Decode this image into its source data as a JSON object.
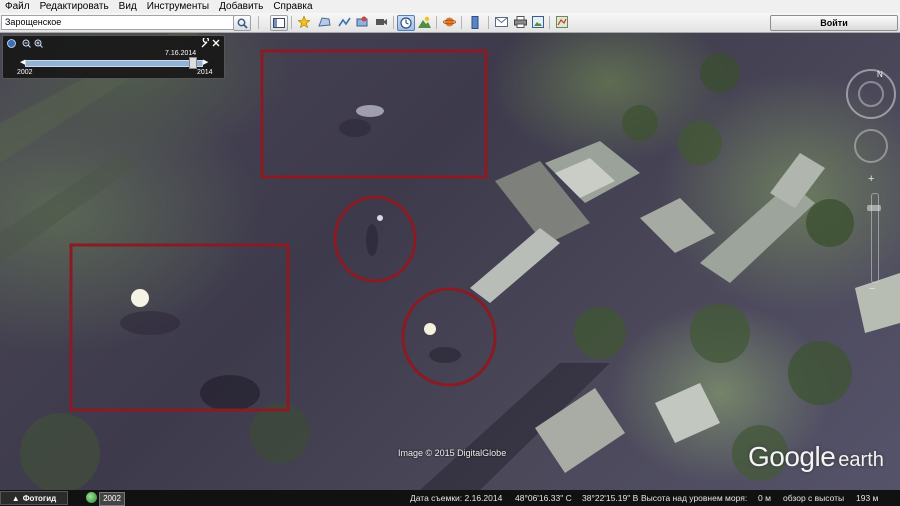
{
  "menu": [
    "Файл",
    "Редактировать",
    "Вид",
    "Инструменты",
    "Добавить",
    "Справка"
  ],
  "search": {
    "value": "Зарощенское"
  },
  "toolbar": {
    "go_label": "Войти",
    "buttons": [
      "search-icon",
      "sidebar-icon",
      "placemark-icon",
      "polygon-icon",
      "path-icon",
      "overlay-icon",
      "record-tour-icon",
      "historical-imagery-icon",
      "sunlight-icon",
      "planets-icon",
      "ruler-icon",
      "email-icon",
      "print-icon",
      "save-image-icon",
      "maps-icon"
    ]
  },
  "timeslider": {
    "current_date": "7.16.2014",
    "start_year": "2002",
    "end_year": "2014"
  },
  "map": {
    "copyright": "Image © 2015 DigitalGlobe",
    "logo_google": "Google",
    "logo_earth": "earth",
    "compass_label": "N",
    "zoom_plus": "+",
    "zoom_minus": "−",
    "annotation_color": "#8b1a22"
  },
  "status": {
    "tour_label": "Фотогид",
    "year_badge": "2002",
    "capture_date": "Дата съемки: 2.16.2014",
    "lat": "48°06'16.33\" С",
    "lon": "38°22'15.19\" В",
    "elevation_label": "Высота над уровнем моря:",
    "elevation_value": "0 м",
    "eye_label": "обзор с высоты",
    "eye_value": "193 м"
  }
}
